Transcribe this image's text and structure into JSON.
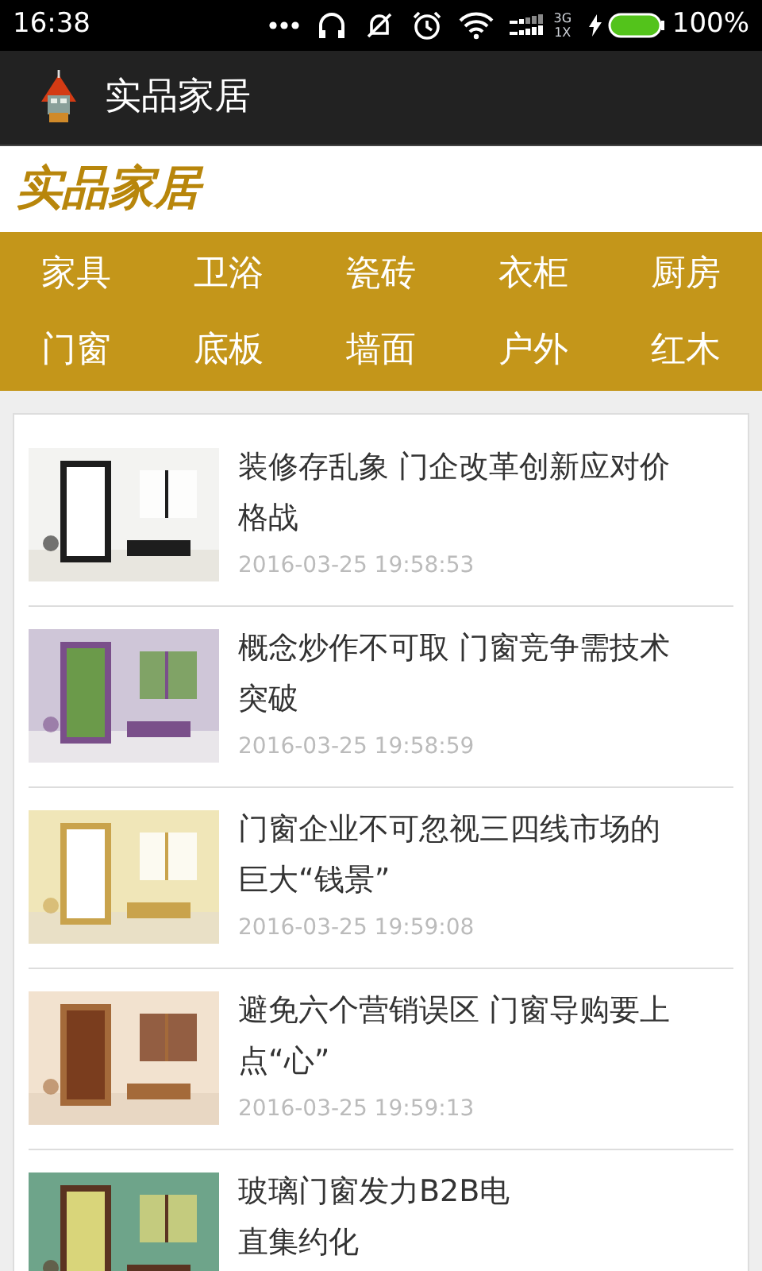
{
  "status_bar": {
    "time": "16:38",
    "network": "3G 1X",
    "battery": "100%"
  },
  "app_bar": {
    "title": "实品家居"
  },
  "brand": {
    "title": "实品家居"
  },
  "categories": [
    {
      "label": "家具"
    },
    {
      "label": "卫浴"
    },
    {
      "label": "瓷砖"
    },
    {
      "label": "衣柜"
    },
    {
      "label": "厨房"
    },
    {
      "label": "门窗"
    },
    {
      "label": "底板"
    },
    {
      "label": "墙面"
    },
    {
      "label": "户外"
    },
    {
      "label": "红木"
    }
  ],
  "articles": [
    {
      "title_lines": [
        "装修存乱象 门企改革创新应对价",
        "格战"
      ],
      "date": "2016-03-25 19:58:53"
    },
    {
      "title_lines": [
        "概念炒作不可取 门窗竞争需技术",
        "突破"
      ],
      "date": "2016-03-25 19:58:59"
    },
    {
      "title_lines": [
        "门窗企业不可忽视三四线市场的",
        "巨大“钱景”"
      ],
      "date": "2016-03-25 19:59:08"
    },
    {
      "title_lines": [
        "避免六个营销误区 门窗导购要上",
        "点“心”"
      ],
      "date": "2016-03-25 19:59:13"
    },
    {
      "title_lines": [
        "玻璃门窗发力B2B电",
        "直集约化"
      ]
    }
  ]
}
